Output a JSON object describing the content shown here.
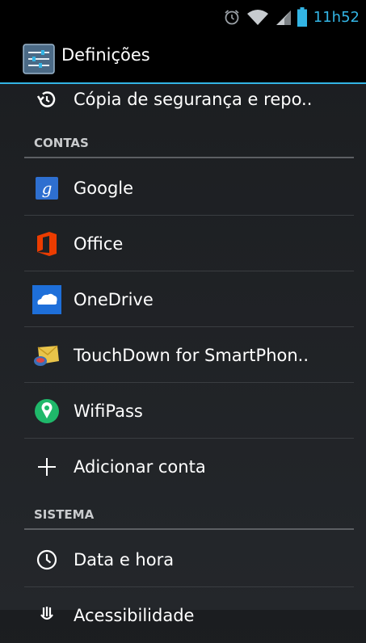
{
  "status_bar": {
    "icons": [
      "alarm-icon",
      "wifi-icon",
      "signal-icon",
      "battery-icon"
    ],
    "time": "11h52",
    "accent_color": "#33b5e5"
  },
  "action_bar": {
    "icon": "settings-icon",
    "title": "Definições"
  },
  "partial_top_item": {
    "icon": "backup-restore-icon",
    "label": "Cópia de segurança e repo.."
  },
  "sections": {
    "accounts_header": "CONTAS",
    "accounts": [
      {
        "icon": "google-icon",
        "label": "Google"
      },
      {
        "icon": "office-icon",
        "label": "Office"
      },
      {
        "icon": "onedrive-icon",
        "label": "OneDrive"
      },
      {
        "icon": "touchdown-icon",
        "label": "TouchDown for SmartPhon.."
      },
      {
        "icon": "wifipass-icon",
        "label": "WifiPass"
      },
      {
        "icon": "plus-icon",
        "label": "Adicionar conta"
      }
    ],
    "system_header": "SISTEMA",
    "system": [
      {
        "icon": "clock-icon",
        "label": "Data e hora"
      },
      {
        "icon": "accessibility-icon",
        "label": "Acessibilidade"
      }
    ]
  }
}
